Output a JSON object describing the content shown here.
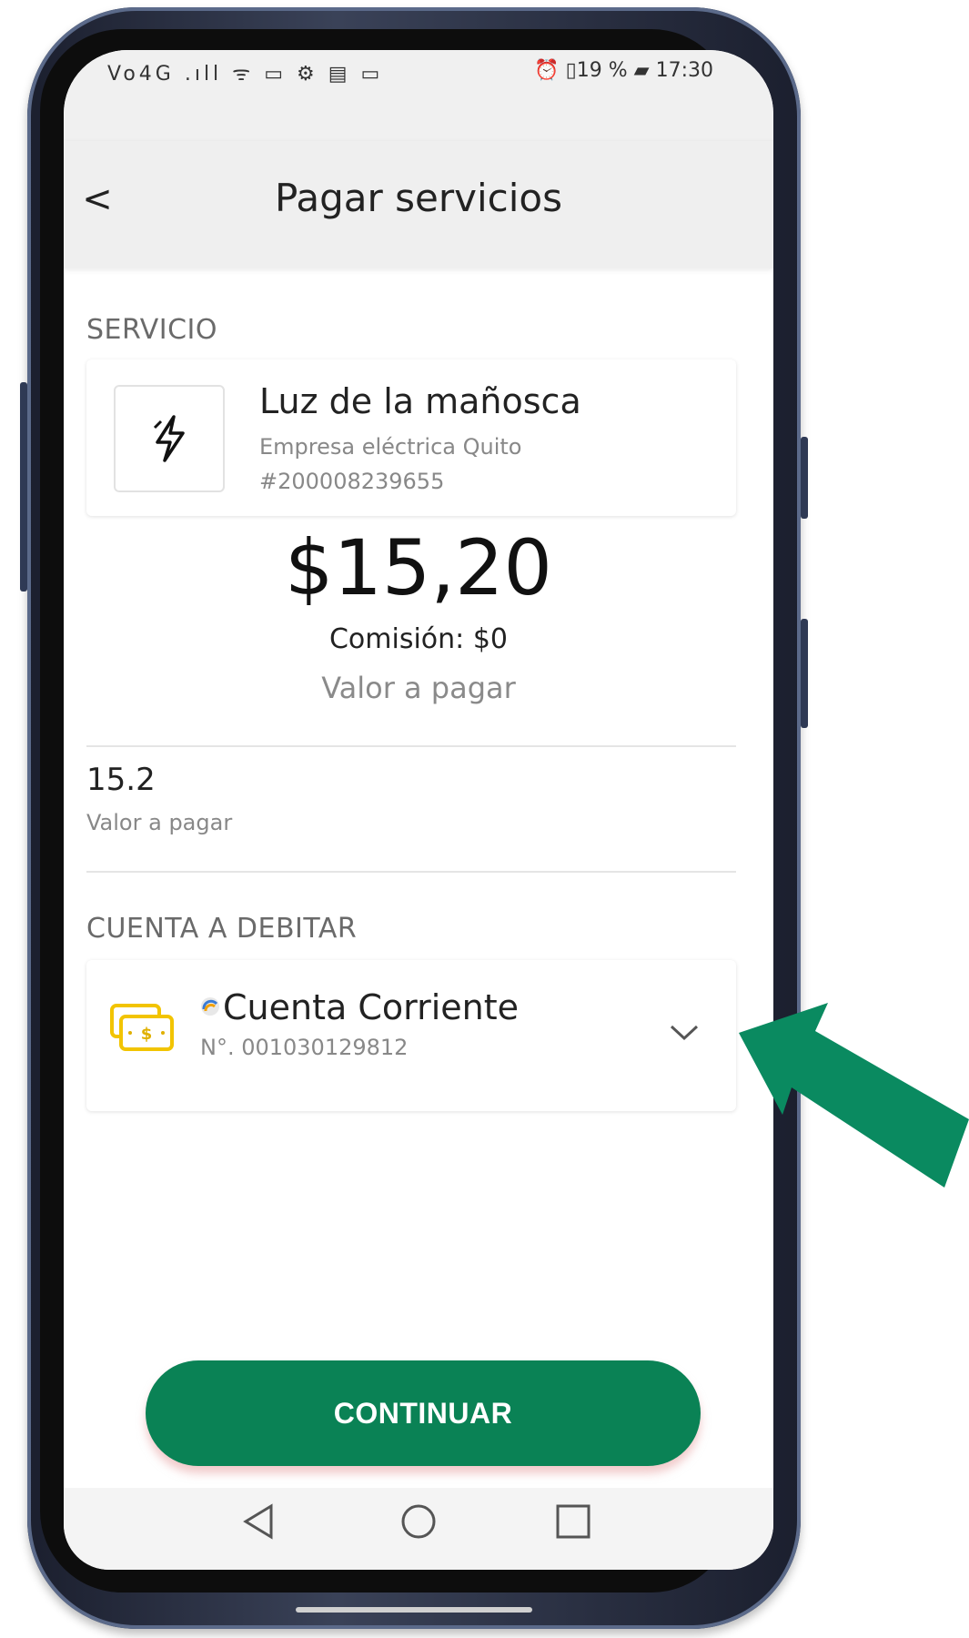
{
  "statusbar": {
    "left_icons": "Vo4G .ıll ᯤ ▭ ⚙ ▤ ▭",
    "right": "⏰ ▯19 % ▰ 17:30"
  },
  "appbar": {
    "back": "<",
    "title": "Pagar servicios"
  },
  "service": {
    "section_label": "SERVICIO",
    "icon": "lightning-icon",
    "name": "Luz de la mañosca",
    "company": "Empresa eléctrica Quito",
    "number": "#200008239655"
  },
  "payment": {
    "amount": "$15,20",
    "commission": "Comisión: $0",
    "caption": "Valor a pagar"
  },
  "value_field": {
    "value": "15.2",
    "label": "Valor a pagar"
  },
  "account": {
    "section_label": "CUENTA A DEBITAR",
    "icon": "money-icon",
    "name": "Cuenta Corriente",
    "number": "N°. 001030129812"
  },
  "actions": {
    "continue_label": "CONTINUAR"
  },
  "colors": {
    "primary": "#0a8255",
    "arrow": "#0a8a60",
    "money_icon": "#f2c400"
  }
}
